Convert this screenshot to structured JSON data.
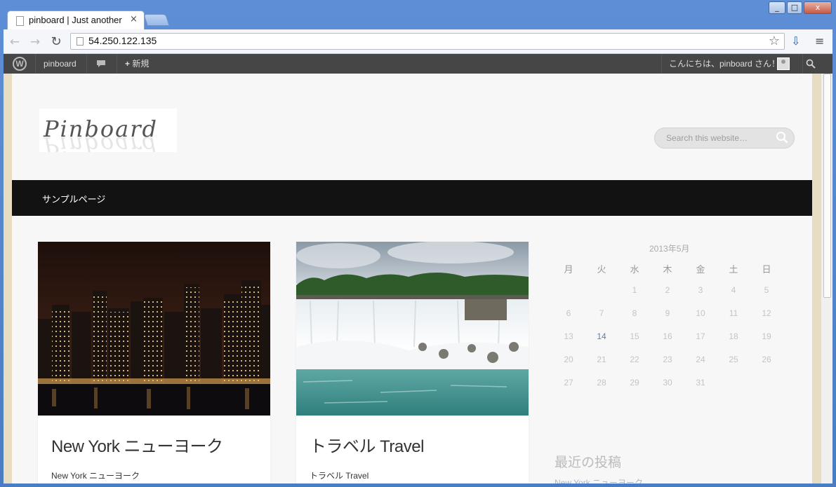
{
  "browser": {
    "tab_title": "pinboard | Just another",
    "tab_close": "×",
    "url": "54.250.122.135",
    "window_minimize": "_",
    "window_maximize": "□",
    "window_close": "x"
  },
  "adminbar": {
    "site_name": "pinboard",
    "new_label": "新規",
    "greeting": "こんにちは、pinboard さん！"
  },
  "site": {
    "logo_text": "Pinboard",
    "search_placeholder": "Search this website…",
    "nav_items": [
      "サンプルページ"
    ]
  },
  "posts": [
    {
      "title": "New York ニューヨーク",
      "excerpt": "New York ニューヨーク",
      "image": "city-skyline-night"
    },
    {
      "title": "トラベル Travel",
      "excerpt": "トラベル Travel",
      "image": "waterfall"
    }
  ],
  "calendar": {
    "caption": "2013年5月",
    "weekdays": [
      "月",
      "火",
      "水",
      "木",
      "金",
      "土",
      "日"
    ],
    "weeks": [
      [
        "",
        "",
        "1",
        "2",
        "3",
        "4",
        "5"
      ],
      [
        "6",
        "7",
        "8",
        "9",
        "10",
        "11",
        "12"
      ],
      [
        "13",
        "14",
        "15",
        "16",
        "17",
        "18",
        "19"
      ],
      [
        "20",
        "21",
        "22",
        "23",
        "24",
        "25",
        "26"
      ],
      [
        "27",
        "28",
        "29",
        "30",
        "31",
        "",
        ""
      ]
    ],
    "linked_day": "14"
  },
  "sidebar": {
    "recent_posts_title": "最近の投稿",
    "recent_posts": [
      "New York ニューヨーク"
    ]
  },
  "colors": {
    "navbar_bg": "#121212",
    "adminbar_bg": "#464646",
    "link": "#5b7fb0"
  }
}
